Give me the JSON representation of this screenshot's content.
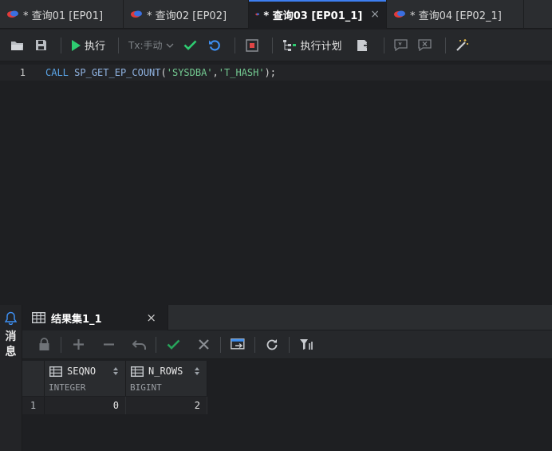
{
  "tabs": [
    {
      "label": "* 查询01 [EP01]",
      "active": false
    },
    {
      "label": "* 查询02 [EP02]",
      "active": false
    },
    {
      "label": "* 查询03 [EP01_1]",
      "active": true,
      "close": "×"
    },
    {
      "label": "* 查询04 [EP02_1]",
      "active": false
    }
  ],
  "toolbar": {
    "execute_label": "执行",
    "tx_mode_label": "Tx:手动",
    "plan_label": "执行计划"
  },
  "editor": {
    "line_number": "1",
    "code": {
      "keyword": "CALL",
      "procedure": "SP_GET_EP_COUNT",
      "open": "(",
      "arg1": "'SYSDBA'",
      "comma": ",",
      "arg2": "'T_HASH'",
      "close": ");"
    }
  },
  "side_panel": {
    "label_chars": [
      "消",
      "息"
    ]
  },
  "results": {
    "tab_label": "结果集1_1",
    "tab_close": "×",
    "columns": [
      {
        "name": "SEQNO",
        "type": "INTEGER"
      },
      {
        "name": "N_ROWS",
        "type": "BIGINT"
      }
    ],
    "rows": [
      {
        "index": "1",
        "values": [
          "0",
          "2"
        ]
      }
    ]
  },
  "colors": {
    "accent": "#3d7ef0",
    "execute_green": "#2ecc71",
    "string_green": "#73c991",
    "keyword_blue": "#5aa4e6"
  }
}
